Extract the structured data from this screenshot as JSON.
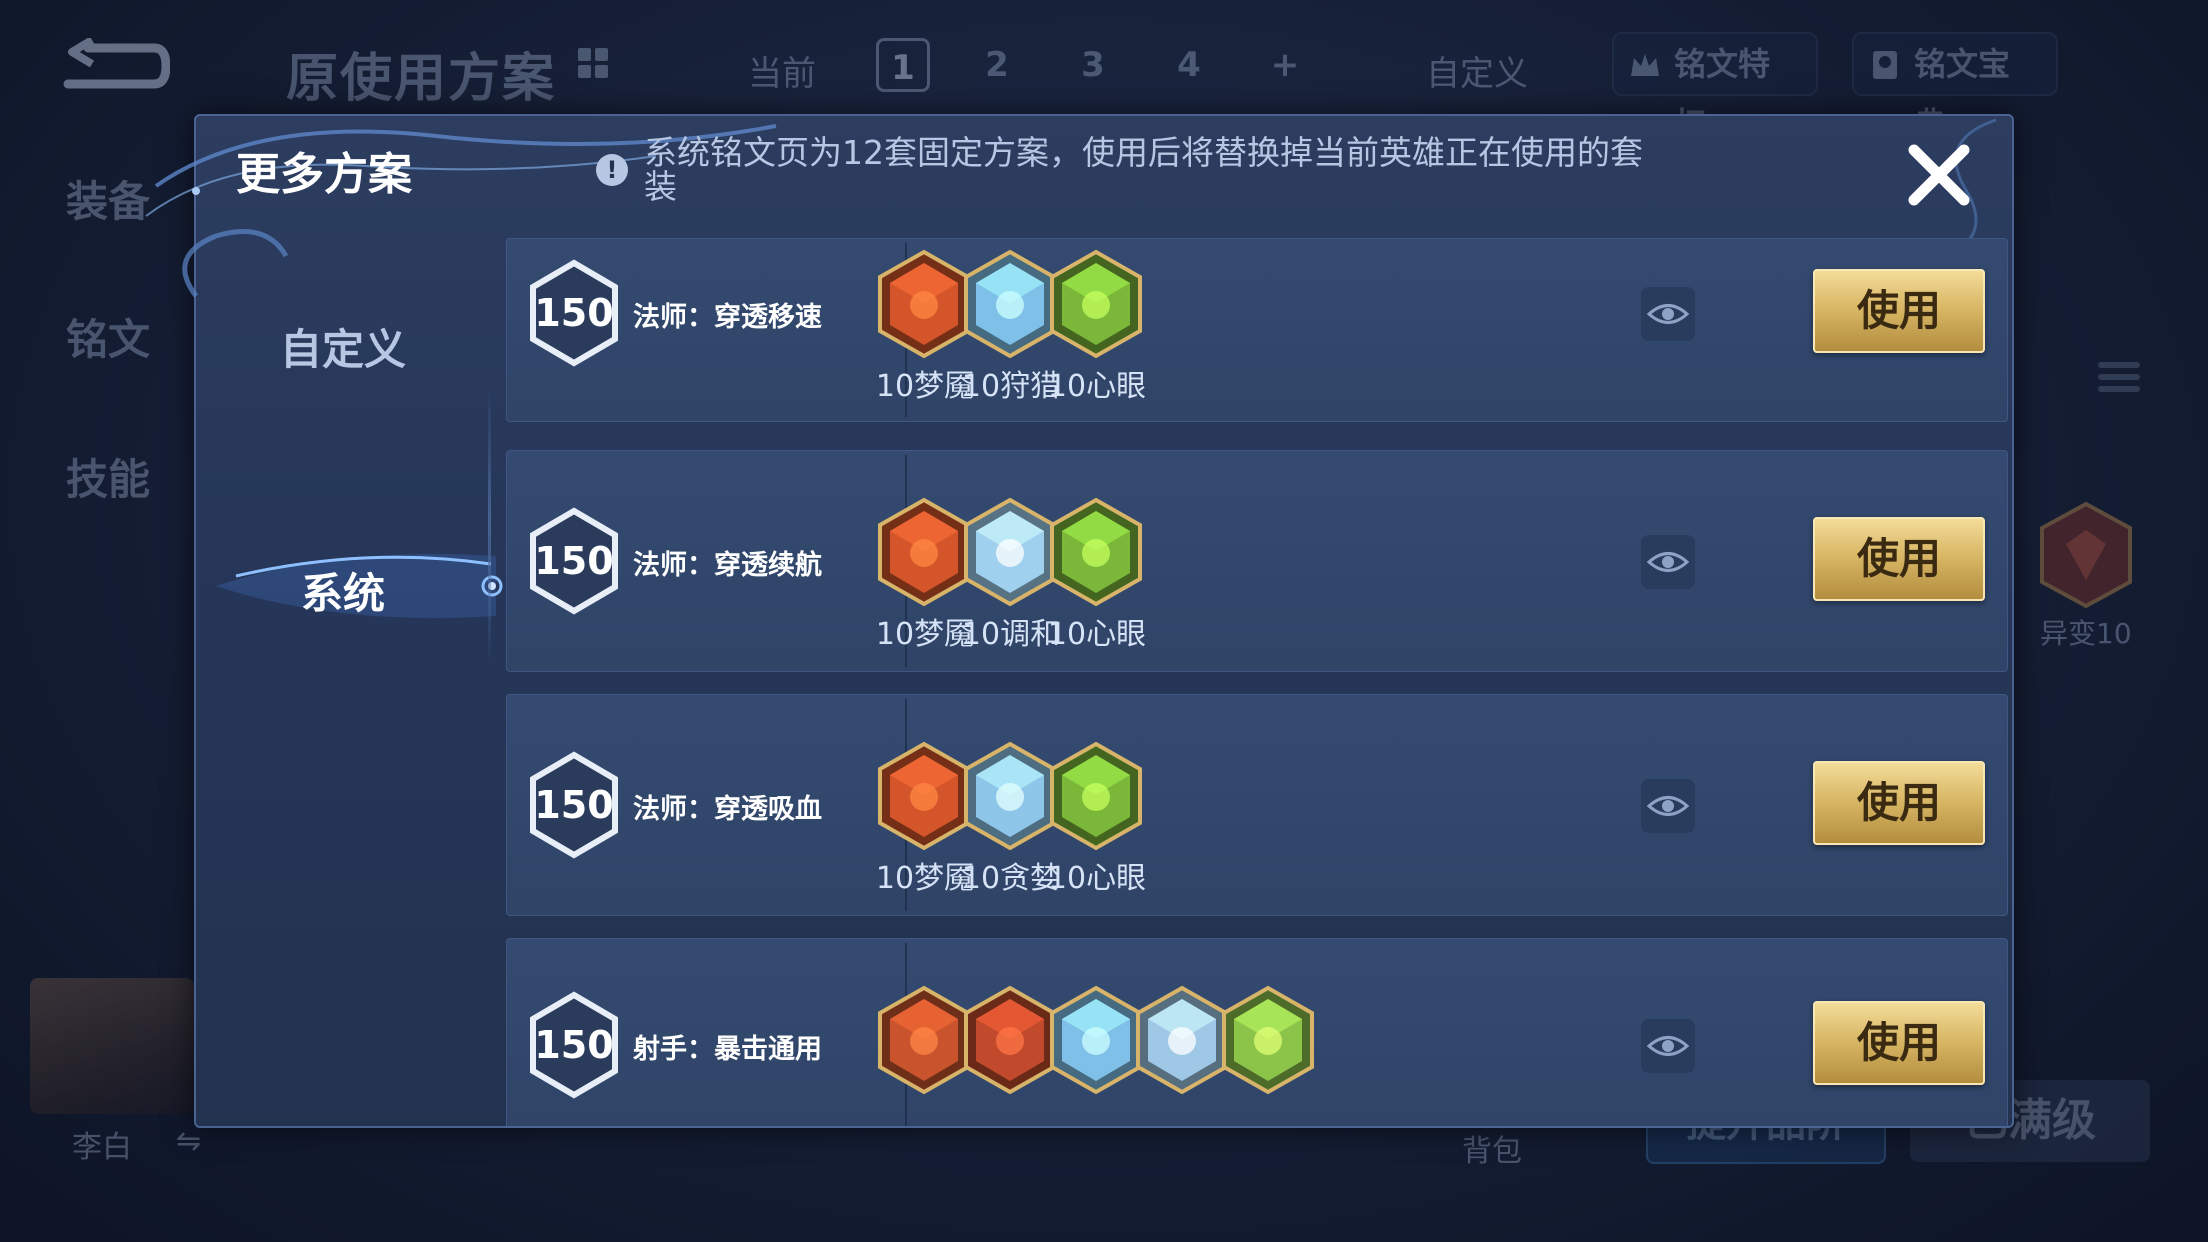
{
  "background": {
    "scheme_title": "原使用方案",
    "current_label": "当前",
    "page_tabs": [
      "1",
      "2",
      "3",
      "4",
      "+"
    ],
    "active_page": "1",
    "custom_label": "自定义",
    "privilege_label": "铭文特权",
    "codex_label": "铭文宝典",
    "side_tabs": [
      "装备",
      "铭文",
      "技能"
    ],
    "mutation_label": "异变10",
    "hero_name": "李白",
    "swap_symbol": "⇋",
    "bag_label": "背包",
    "upgrade_label": "提升品阶",
    "max_label": "已满级"
  },
  "modal": {
    "title": "更多方案",
    "notice": "系统铭文页为12套固定方案，使用后将替换掉当前英雄正在使用的套装",
    "nav": {
      "custom": "自定义",
      "system": "系统"
    },
    "use_label": "使用",
    "rows": [
      {
        "level": "150",
        "name": "法师：穿透移速",
        "runes": [
          {
            "label": "10梦魇",
            "color": "#d4552a",
            "icon": "red-dragon-rune-icon"
          },
          {
            "label": "10狩猎",
            "color": "#7fc0e8",
            "icon": "blue-lightning-rune-icon"
          },
          {
            "label": "10心眼",
            "color": "#7bb83a",
            "icon": "green-eye-rune-icon"
          }
        ]
      },
      {
        "level": "150",
        "name": "法师：穿透续航",
        "runes": [
          {
            "label": "10梦魇",
            "color": "#d4552a",
            "icon": "red-dragon-rune-icon"
          },
          {
            "label": "10调和",
            "color": "#9fd0ee",
            "icon": "blue-drop-rune-icon"
          },
          {
            "label": "10心眼",
            "color": "#7bb83a",
            "icon": "green-eye-rune-icon"
          }
        ]
      },
      {
        "level": "150",
        "name": "法师：穿透吸血",
        "runes": [
          {
            "label": "10梦魇",
            "color": "#d4552a",
            "icon": "red-dragon-rune-icon"
          },
          {
            "label": "10贪婪",
            "color": "#8ec6ea",
            "icon": "blue-star-rune-icon"
          },
          {
            "label": "10心眼",
            "color": "#7bb83a",
            "icon": "green-eye-rune-icon"
          }
        ]
      },
      {
        "level": "150",
        "name": "射手：暴击通用",
        "runes": [
          {
            "label": "",
            "color": "#c9532c",
            "icon": "red-rose-rune-icon"
          },
          {
            "label": "",
            "color": "#c24a2c",
            "icon": "red-claw-rune-icon"
          },
          {
            "label": "",
            "color": "#7fc0e8",
            "icon": "blue-lightning-rune-icon"
          },
          {
            "label": "",
            "color": "#9ec8e6",
            "icon": "blue-knot-rune-icon"
          },
          {
            "label": "",
            "color": "#8cc44a",
            "icon": "green-clover-rune-icon"
          }
        ]
      }
    ]
  }
}
